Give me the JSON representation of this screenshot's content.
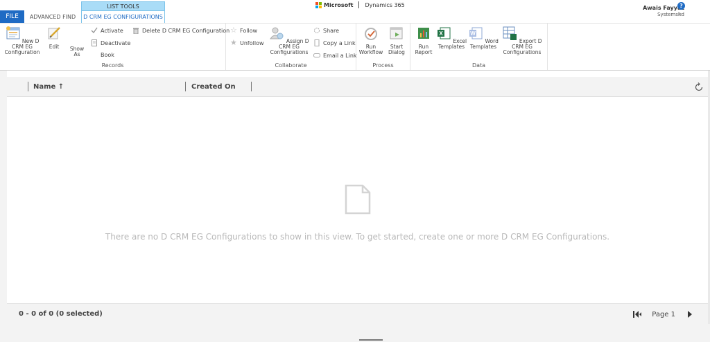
{
  "tabs": {
    "file": "FILE",
    "advanced_find": "ADVANCED FIND",
    "context_group": "LIST TOOLS",
    "context_tab": "D CRM EG CONFIGURATIONS"
  },
  "brand": {
    "microsoft": "Microsoft",
    "product": "Dynamics 365"
  },
  "user": {
    "name": "Awais Fayyaz",
    "org": "Systemsltd",
    "help": "?",
    "collapse": "⌃"
  },
  "ribbon": {
    "records": {
      "label": "Records",
      "new": "New D CRM EG Configuration",
      "edit": "Edit",
      "show_as": "Show As",
      "activate": "Activate",
      "deactivate": "Deactivate",
      "book": "Book",
      "delete": "Delete D CRM EG Configuration"
    },
    "collaborate": {
      "label": "Collaborate",
      "follow": "Follow",
      "unfollow": "Unfollow",
      "assign": "Assign D CRM EG Configurations",
      "share": "Share",
      "copy_link": "Copy a Link",
      "email_link": "Email a Link"
    },
    "process": {
      "label": "Process",
      "run_workflow": "Run Workflow",
      "start_dialog": "Start Dialog"
    },
    "data": {
      "label": "Data",
      "run_report": "Run Report",
      "excel_templates": "Excel Templates",
      "word_templates": "Word Templates",
      "export": "Export D CRM EG Configurations"
    }
  },
  "grid": {
    "columns": [
      "Name ↑",
      "Created On"
    ],
    "empty_message": "There are no D CRM EG Configurations to show in this view. To get started, create one or more D CRM EG Configurations.",
    "count": "0 - 0 of 0 (0 selected)",
    "page": "Page 1"
  },
  "colors": {
    "file_tab": "#1f6bc4",
    "context_header": "#a9dcf7",
    "ms_red": "#f25022",
    "ms_green": "#7fba00",
    "ms_blue": "#00a4ef",
    "ms_yellow": "#ffb900"
  }
}
